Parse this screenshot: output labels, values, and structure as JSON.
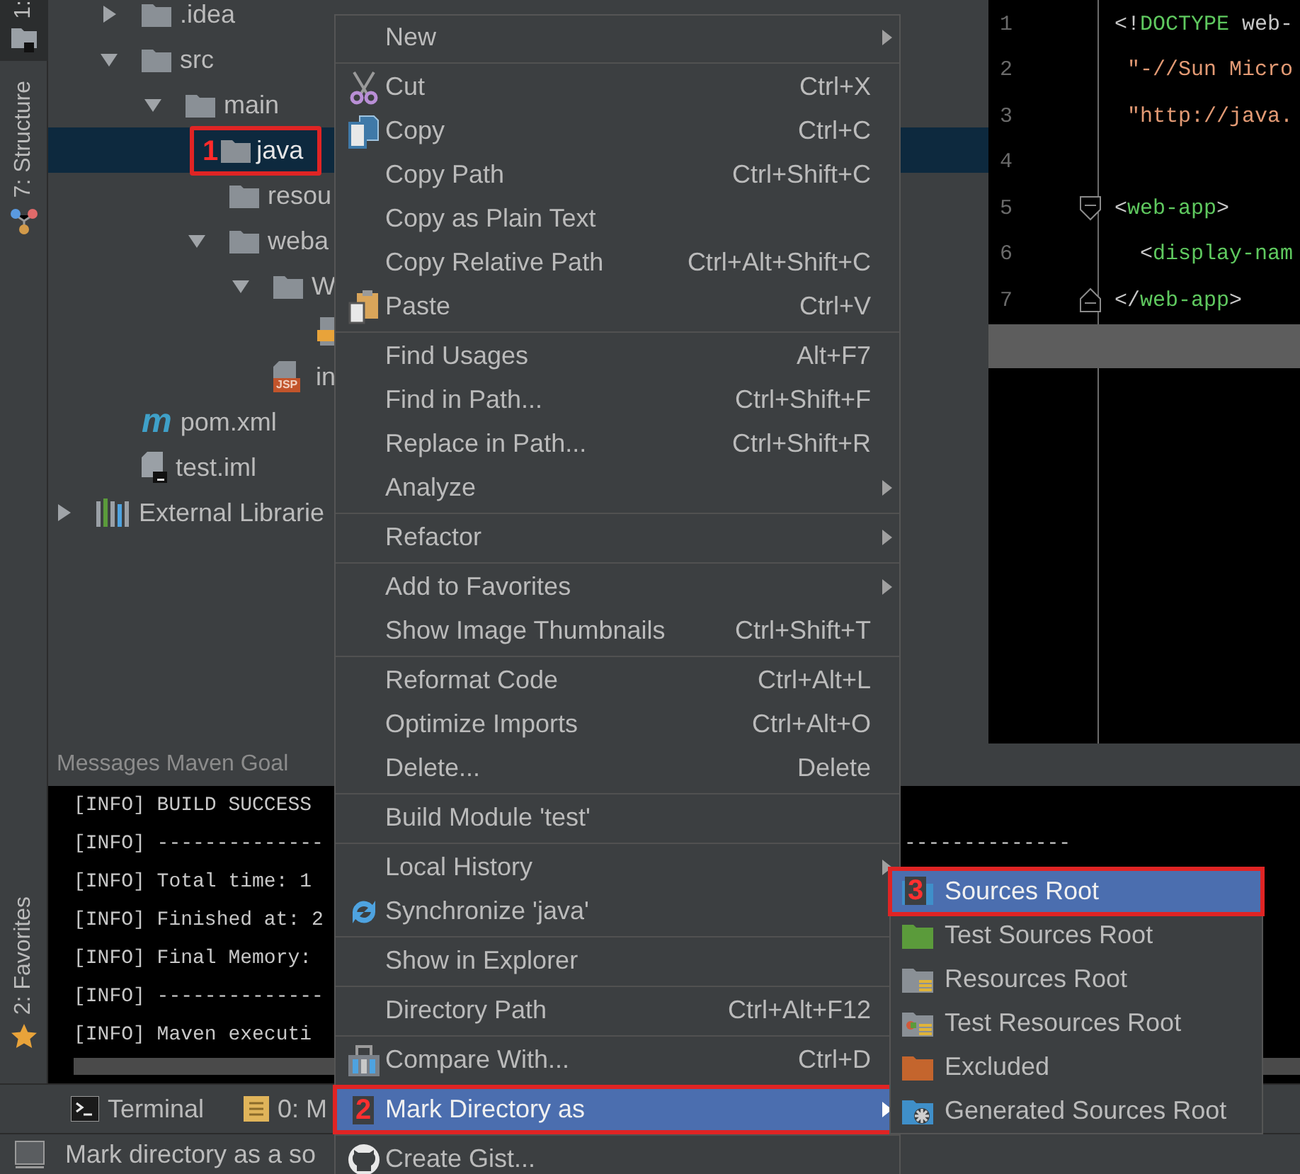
{
  "tool_strip": {
    "tabs": [
      {
        "label": "1:",
        "selected": true
      },
      {
        "label": "7: Structure",
        "selected": false
      },
      {
        "label": "2: Favorites",
        "selected": false
      }
    ]
  },
  "project": {
    "tree": [
      {
        "label": ".idea",
        "kind": "folder",
        "expanded": false,
        "selected": false
      },
      {
        "label": "src",
        "kind": "folder",
        "expanded": true,
        "selected": false,
        "children": [
          {
            "label": "main",
            "kind": "folder",
            "expanded": true,
            "selected": false,
            "children": [
              {
                "label": "java",
                "kind": "folder",
                "selected": true,
                "annotation": "1"
              },
              {
                "label": "resou",
                "kind": "folder",
                "selected": false
              },
              {
                "label": "weba",
                "kind": "folder",
                "expanded": true,
                "selected": false,
                "children": [
                  {
                    "label": "W",
                    "kind": "folder",
                    "expanded": true,
                    "selected": false,
                    "children": [
                      {
                        "kind": "xml"
                      }
                    ]
                  },
                  {
                    "label": "in",
                    "kind": "jsp",
                    "badge": "JSP",
                    "selected": false
                  }
                ]
              }
            ]
          }
        ]
      },
      {
        "label": "pom.xml",
        "kind": "maven",
        "icon_text": "m",
        "selected": false
      },
      {
        "label": "test.iml",
        "kind": "module",
        "selected": false
      }
    ],
    "libraries": {
      "label": "External Librarie",
      "expanded": false
    }
  },
  "editor": {
    "lines": [
      {
        "number": "1",
        "kind": "plain",
        "tokens": [
          {
            "kind": "punct",
            "text": "<!"
          },
          {
            "kind": "tag",
            "text": "DOCTYPE"
          },
          {
            "kind": "text",
            "text": " web-"
          }
        ]
      },
      {
        "number": "2",
        "kind": "plain",
        "tokens": [
          {
            "kind": "string",
            "text": " \"-//Sun Micro"
          }
        ]
      },
      {
        "number": "3",
        "kind": "plain",
        "tokens": [
          {
            "kind": "string",
            "text": " \"http://java."
          }
        ]
      },
      {
        "number": "4",
        "kind": "plain"
      },
      {
        "number": "5",
        "kind": "fold-start",
        "tokens": [
          {
            "kind": "punct",
            "text": "<"
          },
          {
            "kind": "tag",
            "text": "web-app"
          },
          {
            "kind": "punct",
            "text": ">"
          }
        ]
      },
      {
        "number": "6",
        "kind": "plain",
        "tokens": [
          {
            "kind": "punct",
            "text": "  <"
          },
          {
            "kind": "tag",
            "text": "display-nam"
          }
        ]
      },
      {
        "number": "7",
        "kind": "fold-end",
        "tokens": [
          {
            "kind": "punct",
            "text": "</"
          },
          {
            "kind": "tag",
            "text": "web-app"
          },
          {
            "kind": "punct",
            "text": ">"
          }
        ]
      }
    ]
  },
  "messages": {
    "header": "Messages Maven Goal",
    "lines": [
      {
        "text": "[INFO] BUILD SUCCESS"
      },
      {
        "text": "[INFO] --------------",
        "tail": "--------------"
      },
      {
        "text": "[INFO] Total time: 1"
      },
      {
        "text": "[INFO] Finished at: 2"
      },
      {
        "text": "[INFO] Final Memory:"
      },
      {
        "text": "[INFO] --------------"
      },
      {
        "text": "[INFO] Maven executi"
      }
    ]
  },
  "tool_tabs": [
    {
      "label": "Terminal",
      "selected": false
    },
    {
      "label": "0: M",
      "selected": false
    }
  ],
  "status_bar": {
    "text": "Mark directory as a so"
  },
  "context_menu": {
    "groups": [
      [
        {
          "label": "New",
          "submenu": true,
          "selected": false
        }
      ],
      [
        {
          "label": "Cut",
          "shortcut": "Ctrl+X",
          "submenu": false,
          "selected": false
        },
        {
          "label": "Copy",
          "shortcut": "Ctrl+C",
          "submenu": false,
          "selected": false
        },
        {
          "label": "Copy Path",
          "shortcut": "Ctrl+Shift+C",
          "submenu": false,
          "selected": false
        },
        {
          "label": "Copy as Plain Text",
          "submenu": false,
          "selected": false
        },
        {
          "label": "Copy Relative Path",
          "shortcut": "Ctrl+Alt+Shift+C",
          "submenu": false,
          "selected": false
        },
        {
          "label": "Paste",
          "shortcut": "Ctrl+V",
          "submenu": false,
          "selected": false
        }
      ],
      [
        {
          "label": "Find Usages",
          "shortcut": "Alt+F7",
          "submenu": false,
          "selected": false
        },
        {
          "label": "Find in Path...",
          "shortcut": "Ctrl+Shift+F",
          "submenu": false,
          "selected": false
        },
        {
          "label": "Replace in Path...",
          "shortcut": "Ctrl+Shift+R",
          "submenu": false,
          "selected": false
        },
        {
          "label": "Analyze",
          "submenu": true,
          "selected": false
        }
      ],
      [
        {
          "label": "Refactor",
          "submenu": true,
          "selected": false
        }
      ],
      [
        {
          "label": "Add to Favorites",
          "submenu": true,
          "selected": false
        },
        {
          "label": "Show Image Thumbnails",
          "shortcut": "Ctrl+Shift+T",
          "submenu": false,
          "selected": false
        }
      ],
      [
        {
          "label": "Reformat Code",
          "shortcut": "Ctrl+Alt+L",
          "submenu": false,
          "selected": false
        },
        {
          "label": "Optimize Imports",
          "shortcut": "Ctrl+Alt+O",
          "submenu": false,
          "selected": false
        },
        {
          "label": "Delete...",
          "shortcut": "Delete",
          "submenu": false,
          "selected": false
        }
      ],
      [
        {
          "label": "Build Module 'test'",
          "submenu": false,
          "selected": false
        }
      ],
      [
        {
          "label": "Local History",
          "submenu": true,
          "selected": false
        },
        {
          "label": "Synchronize 'java'",
          "submenu": false,
          "selected": false
        }
      ],
      [
        {
          "label": "Show in Explorer",
          "submenu": false,
          "selected": false
        }
      ],
      [
        {
          "label": "Directory Path",
          "shortcut": "Ctrl+Alt+F12",
          "submenu": false,
          "selected": false
        }
      ],
      [
        {
          "label": "Compare With...",
          "shortcut": "Ctrl+D",
          "submenu": false,
          "selected": false
        }
      ],
      [
        {
          "label": "Mark Directory as",
          "submenu": true,
          "selected": true,
          "annotation": "2"
        }
      ],
      [
        {
          "label": "Create Gist...",
          "submenu": false,
          "selected": false
        }
      ]
    ]
  },
  "submenu": {
    "items": [
      {
        "label": "Sources Root",
        "selected": true,
        "annotation": "3"
      },
      {
        "label": "Test Sources Root",
        "selected": false
      },
      {
        "label": "Resources Root",
        "selected": false
      },
      {
        "label": "Test Resources Root",
        "selected": false
      },
      {
        "label": "Excluded",
        "selected": false
      },
      {
        "label": "Generated Sources Root",
        "selected": false
      }
    ]
  }
}
